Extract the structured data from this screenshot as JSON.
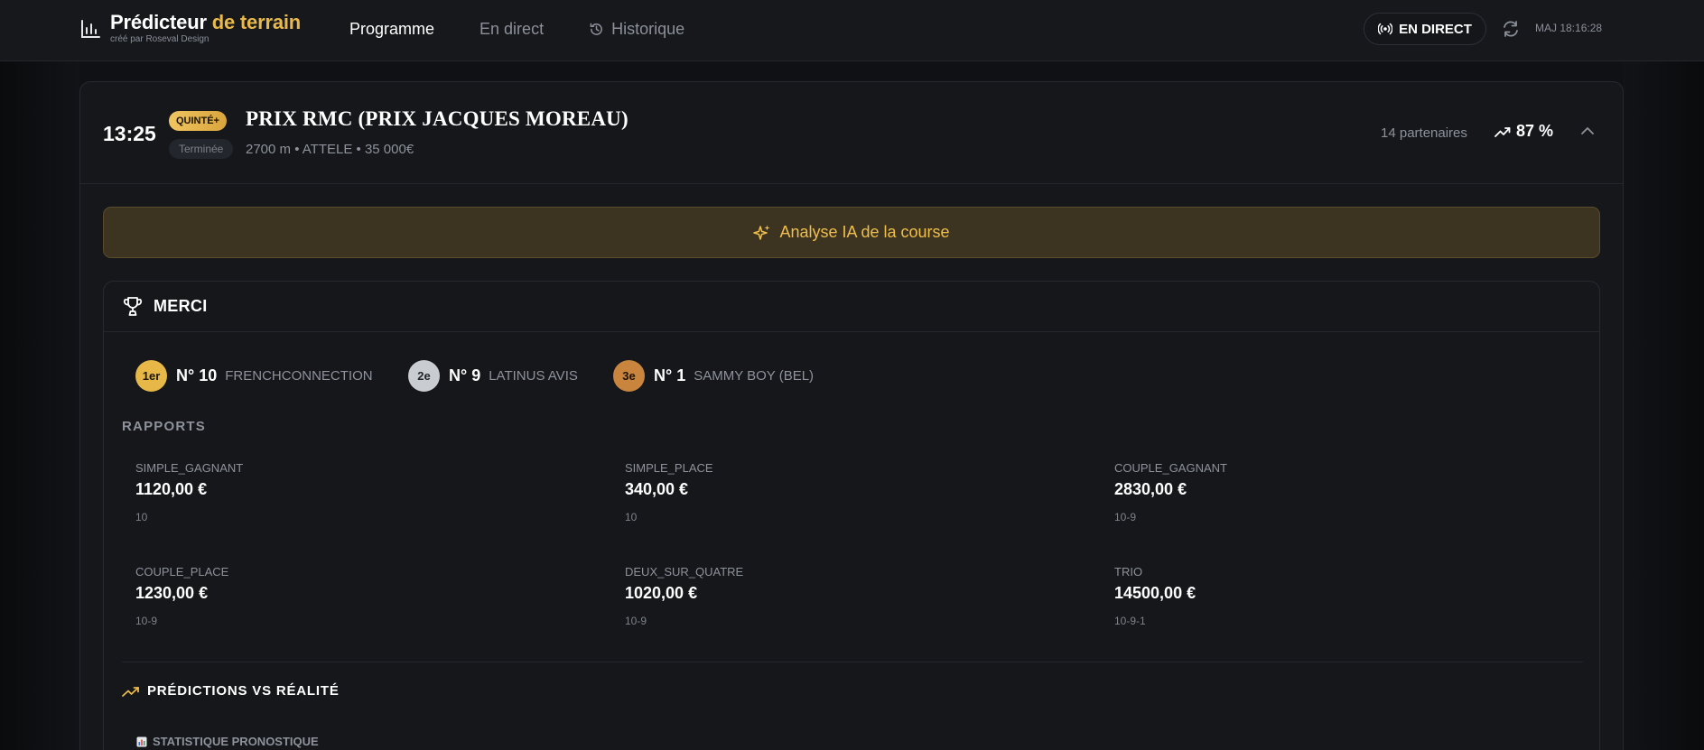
{
  "header": {
    "brand_main": "Prédicteur",
    "brand_accent": "de terrain",
    "brand_sub": "créé par Roseval Design",
    "nav": [
      {
        "label": "Programme",
        "active": true
      },
      {
        "label": "En direct",
        "active": false
      },
      {
        "label": "Historique",
        "active": false
      }
    ],
    "live_label": "EN DIRECT",
    "update_label": "MAJ 18:16:28"
  },
  "race": {
    "time": "13:25",
    "badge": "QUINTÉ+",
    "title": "PRIX RMC (PRIX JACQUES MOREAU)",
    "status": "Terminée",
    "meta": "2700 m • ATTELE • 35 000€",
    "partners": "14 partenaires",
    "confidence": "87 %"
  },
  "ai_button_label": "Analyse IA de la course",
  "result": {
    "title": "MERCI",
    "podium": [
      {
        "rank": "1er",
        "number": "N° 10",
        "name": "FRENCHCONNECTION"
      },
      {
        "rank": "2e",
        "number": "N° 9",
        "name": "LATINUS AVIS"
      },
      {
        "rank": "3e",
        "number": "N° 1",
        "name": "SAMMY BOY (BEL)"
      }
    ],
    "rapports_title": "RAPPORTS",
    "rapports": [
      {
        "label": "SIMPLE_GAGNANT",
        "value": "1120,00 €",
        "combo": "10"
      },
      {
        "label": "SIMPLE_PLACE",
        "value": "340,00 €",
        "combo": "10"
      },
      {
        "label": "COUPLE_GAGNANT",
        "value": "2830,00 €",
        "combo": "10-9"
      },
      {
        "label": "COUPLE_PLACE",
        "value": "1230,00 €",
        "combo": "10-9"
      },
      {
        "label": "DEUX_SUR_QUATRE",
        "value": "1020,00 €",
        "combo": "10-9"
      },
      {
        "label": "TRIO",
        "value": "14500,00 €",
        "combo": "10-9-1"
      }
    ],
    "predictions_title": "PRÉDICTIONS VS RÉALITÉ",
    "stat_title": "STATISTIQUE PRONOSTIQUE"
  },
  "colors": {
    "accent": "#e9b949",
    "background": "#0f1114",
    "card": "#15171b"
  }
}
